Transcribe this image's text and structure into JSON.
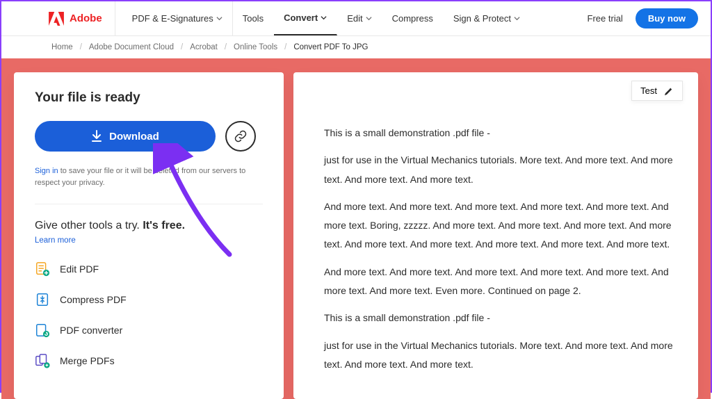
{
  "brand": {
    "name": "Adobe"
  },
  "nav": {
    "pdf_esign": "PDF & E-Signatures",
    "tools": "Tools",
    "convert": "Convert",
    "edit": "Edit",
    "compress": "Compress",
    "sign_protect": "Sign & Protect",
    "free_trial": "Free trial",
    "buy_now": "Buy now"
  },
  "breadcrumb": {
    "home": "Home",
    "doc_cloud": "Adobe Document Cloud",
    "acrobat": "Acrobat",
    "online_tools": "Online Tools",
    "current": "Convert PDF To JPG"
  },
  "left": {
    "ready": "Your file is ready",
    "download": "Download",
    "sign_in": "Sign in",
    "sign_in_rest": " to save your file or it will be deleted from our servers to respect your privacy.",
    "try_title_plain": "Give other tools a try. ",
    "try_title_bold": "It's free.",
    "learn_more": "Learn more",
    "tools": {
      "edit": "Edit PDF",
      "compress": "Compress PDF",
      "converter": "PDF converter",
      "merge": "Merge PDFs"
    }
  },
  "file_chip": {
    "name": "Test"
  },
  "doc": {
    "p1": "This is a small demonstration .pdf file -",
    "p2": "just for use in the Virtual Mechanics tutorials. More text. And more text. And more text. And more text. And more text.",
    "p3": "And more text. And more text. And more text. And more text. And more text. And more text. Boring, zzzzz. And more text. And more text. And more text. And more text. And more text. And more text. And more text. And more text. And more text.",
    "p4": "And more text. And more text. And more text. And more text. And more text. And more text. And more text. Even more. Continued on page 2.",
    "p5": "This is a small demonstration .pdf file -",
    "p6": "just for use in the Virtual Mechanics tutorials. More text. And more text. And more text. And more text. And more text."
  }
}
